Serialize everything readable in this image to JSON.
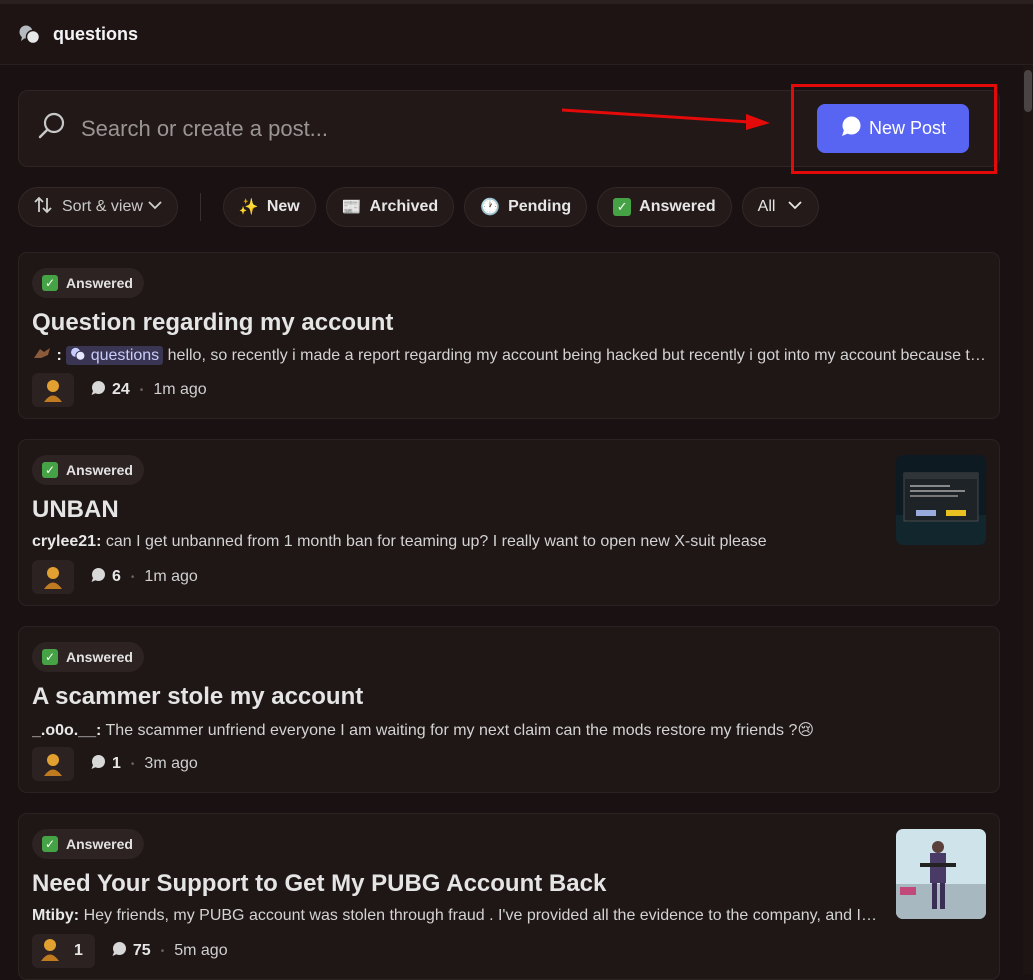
{
  "header": {
    "title": "questions",
    "icon": "forum-icon"
  },
  "search": {
    "placeholder": "Search or create a post..."
  },
  "new_post": {
    "label": "New Post"
  },
  "filters": {
    "sort_label": "Sort & view",
    "tags": [
      {
        "emoji": "✨",
        "label": "New"
      },
      {
        "emoji": "📰",
        "label": "Archived"
      },
      {
        "emoji": "🕐",
        "label": "Pending"
      },
      {
        "emoji": "✅",
        "label": "Answered"
      }
    ],
    "all_label": "All"
  },
  "posts": [
    {
      "tag": "Answered",
      "title": "Question regarding my account",
      "author": "",
      "mention": "questions",
      "preview": "hello, so recently i made a report regarding my account being hacked but recently i got into my account because the email was still linked and now i want to know",
      "comments": "24",
      "time": "1m ago",
      "has_thumb": false
    },
    {
      "tag": "Answered",
      "title": "UNBAN",
      "author": "crylee21:",
      "preview": "can I get unbanned from 1 month ban for teaming up? I really want to open new X-suit please",
      "comments": "6",
      "time": "1m ago",
      "has_thumb": true
    },
    {
      "tag": "Answered",
      "title": "A scammer stole my account",
      "author": "_.o0o.__:",
      "preview": "The scammer unfriend everyone I am waiting for my next claim can the mods restore my friends ?😢",
      "comments": "1",
      "time": "3m ago",
      "has_thumb": false
    },
    {
      "tag": "Answered",
      "title": "Need Your Support to Get My PUBG Account Back",
      "author": "Mtiby:",
      "preview": "Hey friends, my PUBG account was stolen through fraud . I've provided all the evidence to the company, and I'm waiting for their answer",
      "reaction_count": "1",
      "comments": "75",
      "time": "5m ago",
      "has_thumb": true
    }
  ],
  "colors": {
    "accent": "#5865f2",
    "answered": "#45a345",
    "highlight": "#e40a0a"
  }
}
